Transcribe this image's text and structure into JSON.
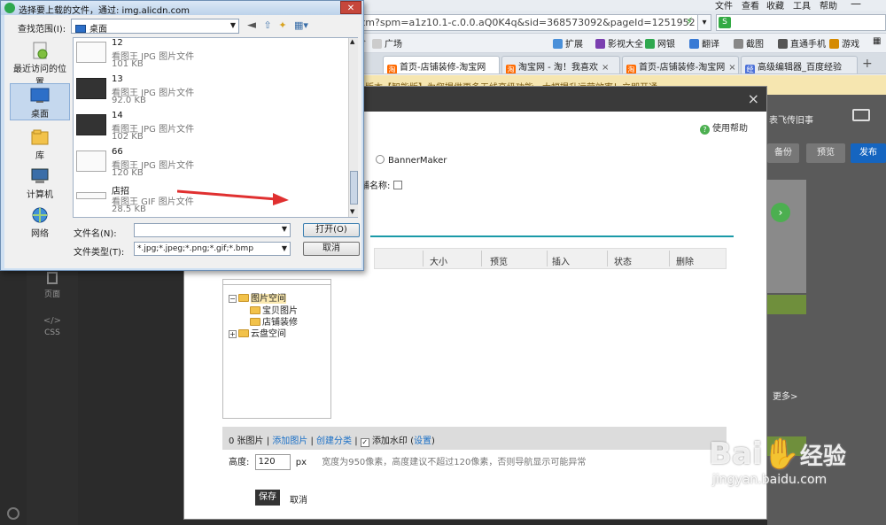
{
  "menubar": {
    "items": [
      "文件",
      "查看",
      "收藏",
      "工具",
      "帮助"
    ]
  },
  "browser": {
    "url": "ntm?spm=a1z10.1-c.0.0.aQ0K4q&sid=368573092&pageId=1251952",
    "go_symbol": "↻"
  },
  "favorites": {
    "broad": "广场",
    "items": [
      "扩展",
      "影视大全",
      "网银",
      "翻译",
      "截图",
      "直通手机",
      "游戏"
    ]
  },
  "tabs": [
    {
      "label": "首页-店铺装修-淘宝网"
    },
    {
      "label": "淘宝网 - 淘！我喜欢"
    },
    {
      "label": "首页-店铺装修-淘宝网"
    },
    {
      "label": "高级编辑器_百度经验"
    }
  ],
  "page": {
    "notice": "版本【智能版】为您提供更多无线高级功能，大幅提升运营效率！立即开通",
    "nav": [
      "页面",
      "CSS"
    ],
    "right": {
      "shop": "表飞传旧事",
      "backup": "备份",
      "preview": "预览",
      "publish": "发布",
      "more": "更多>"
    }
  },
  "modal": {
    "help": "使用帮助",
    "option_banner": "BannerMaker",
    "option_shopname": "铺名称:",
    "columns": [
      "大小",
      "预览",
      "插入",
      "状态",
      "删除"
    ],
    "tree": {
      "root": "图片空间",
      "children": [
        "宝贝图片",
        "店铺装修"
      ],
      "cloud": "云盘空间"
    },
    "imgbar": {
      "count": "0 张图片",
      "add": "添加图片",
      "create": "创建分类",
      "watermark": "添加水印",
      "settings": "设置"
    },
    "height_label": "高度:",
    "height_value": "120",
    "height_unit": "px",
    "height_hint": "宽度为950像素，高度建议不超过120像素，否则导航显示可能异常",
    "save": "保存",
    "cancel": "取消"
  },
  "file_dialog": {
    "title": "选择要上载的文件，通过: img.alicdn.com",
    "lookin_label": "查找范围(I):",
    "lookin_value": "桌面",
    "places": [
      {
        "label": "最近访问的位置"
      },
      {
        "label": "桌面"
      },
      {
        "label": "库"
      },
      {
        "label": "计算机"
      },
      {
        "label": "网络"
      }
    ],
    "files": [
      {
        "name": "12",
        "type": "看图王 JPG 图片文件",
        "size": "101 KB"
      },
      {
        "name": "13",
        "type": "看图王 JPG 图片文件",
        "size": "92.0 KB"
      },
      {
        "name": "14",
        "type": "看图王 JPG 图片文件",
        "size": "102 KB"
      },
      {
        "name": "66",
        "type": "看图王 JPG 图片文件",
        "size": "120 KB"
      },
      {
        "name": "店招",
        "type": "看图王 GIF 图片文件",
        "size": "28.5 KB"
      }
    ],
    "filename_label": "文件名(N):",
    "filename_value": "",
    "filetype_label": "文件类型(T):",
    "filetype_value": "*.jpg;*.jpeg;*.png;*.gif;*.bmp",
    "open": "打开(O)",
    "cancel": "取消"
  },
  "watermark": {
    "brand": "Bai",
    "brand2": "经验",
    "url": "jingyan.baidu.com"
  },
  "colors": {
    "accent": "#1a9aa8",
    "arrow": "#e03030",
    "publish": "#1565c0"
  }
}
